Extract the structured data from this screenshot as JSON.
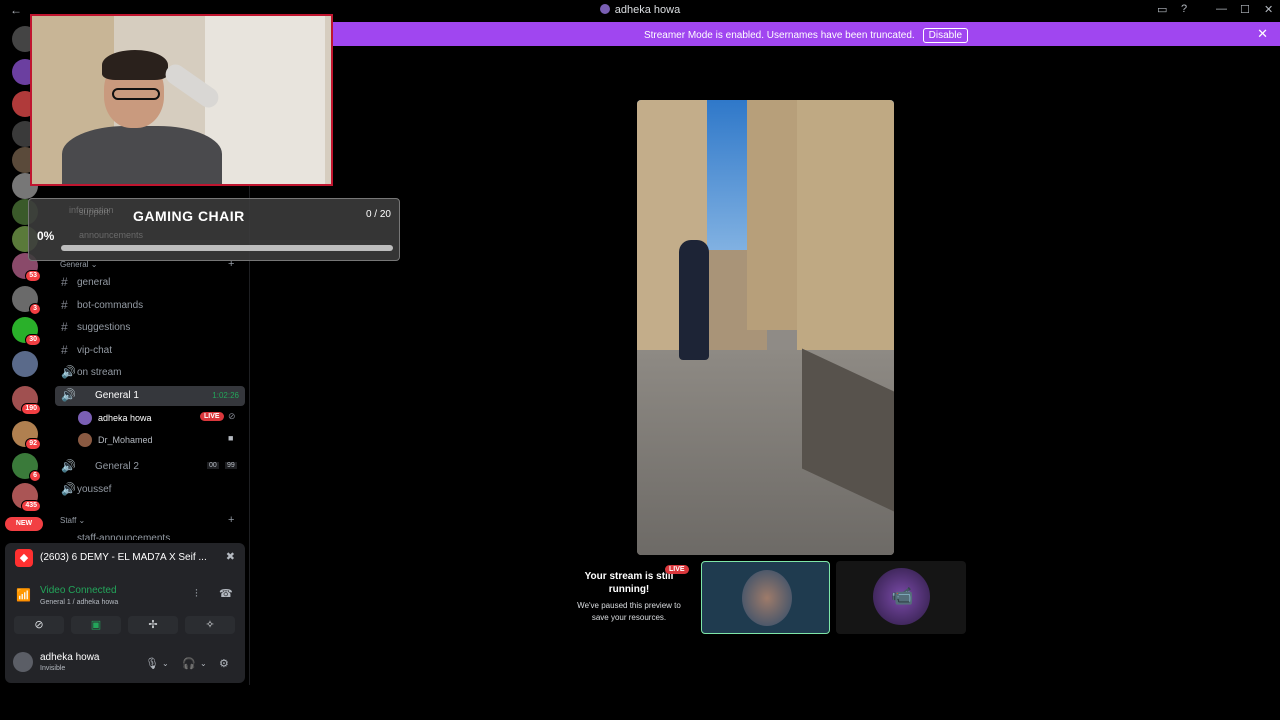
{
  "titlebar": {
    "title": "adheka howa",
    "back": "←",
    "inbox": "▭",
    "help": "?",
    "minimize": "—",
    "maximize": "☐",
    "close": "✕"
  },
  "banner": {
    "message": "Streamer Mode is enabled. Usernames have been truncated.",
    "disable_label": "Disable",
    "close": "✕"
  },
  "servers": [
    {
      "badge": ""
    },
    {
      "badge": ""
    },
    {
      "badge": ""
    },
    {
      "badge": ""
    },
    {
      "badge": ""
    },
    {
      "badge": ""
    },
    {
      "badge": ""
    },
    {
      "badge": ""
    },
    {
      "badge": "53"
    },
    {
      "badge": "3"
    },
    {
      "badge": "30"
    },
    {
      "badge": ""
    },
    {
      "badge": "190"
    },
    {
      "badge": "92"
    },
    {
      "badge": "6"
    },
    {
      "badge": "435"
    }
  ],
  "new_label": "NEW",
  "channels": {
    "ghost_items": [
      "information",
      "support",
      "announcements"
    ],
    "category_general": "General",
    "items": [
      {
        "icon": "#",
        "name": "general"
      },
      {
        "icon": "#",
        "name": "bot-commands"
      },
      {
        "icon": "#",
        "name": "suggestions"
      },
      {
        "icon": "#",
        "name": "vip-chat"
      },
      {
        "icon": "🔊",
        "name": "on stream"
      }
    ],
    "voice1": {
      "name": "General 1",
      "time": "1:02:26"
    },
    "members": [
      {
        "name": "adheka howa",
        "live": "LIVE"
      },
      {
        "name": "Dr_Mohamed"
      }
    ],
    "voice2": {
      "name": "General 2",
      "count_a": "00",
      "count_b": "99"
    },
    "youssef": "youssef",
    "category_staff": "Staff",
    "staff_partial": "staff-announcements"
  },
  "goal": {
    "title": "GAMING CHAIR",
    "count": "0 / 20",
    "percent_label": "0%",
    "progress": 0
  },
  "voice_panel": {
    "activity": "(2603) 6 DEMY - EL MAD7A X Seif ...",
    "status": "Video Connected",
    "sub": "General 1 / adheka howa",
    "user_name": "adheka howa",
    "user_status": "Invisible"
  },
  "preview": {
    "live": "LIVE",
    "line1": "Your stream is still running!",
    "line2": "We've paused this preview to save your resources."
  },
  "colors": {
    "banner": "#a046f0",
    "live": "#da373c",
    "connected": "#23a55a",
    "goal_fill": "#f0c419",
    "webcam_border": "#c0152f"
  }
}
